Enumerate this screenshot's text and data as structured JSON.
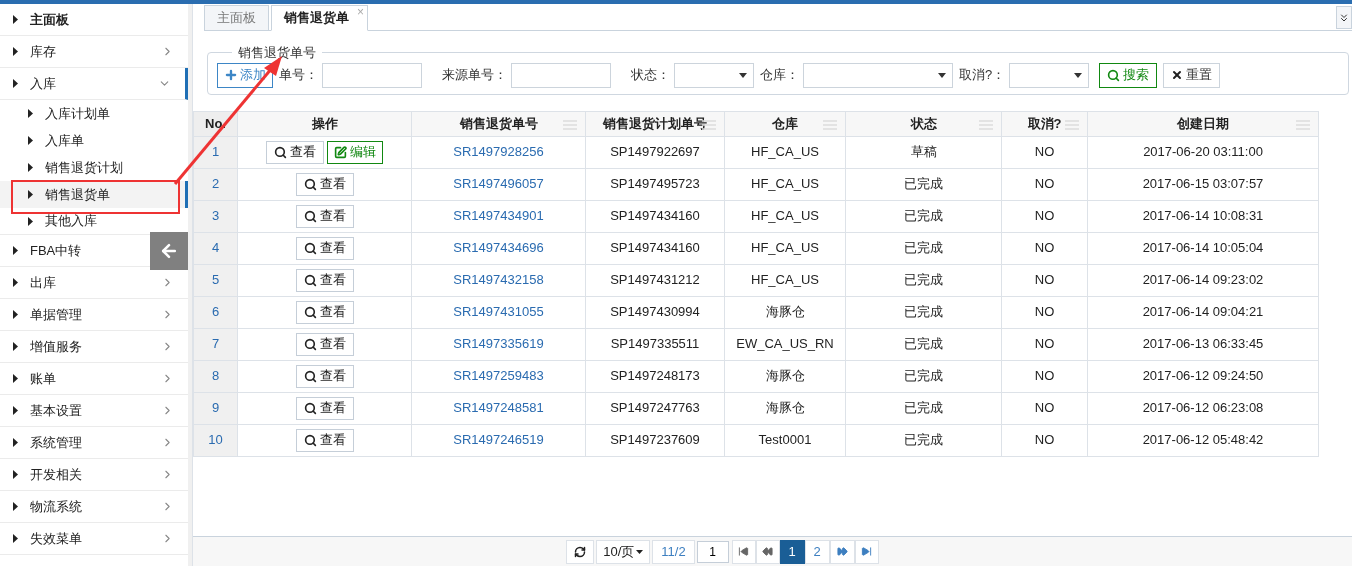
{
  "sidebar": {
    "items": [
      {
        "label": "主面板",
        "bold": true,
        "has_arrow": false,
        "expanded": false
      },
      {
        "label": "库存",
        "bold": false,
        "has_arrow": true,
        "expanded": false
      },
      {
        "label": "入库",
        "bold": false,
        "has_arrow": true,
        "expanded": true,
        "children": [
          {
            "label": "入库计划单",
            "selected": false
          },
          {
            "label": "入库单",
            "selected": false
          },
          {
            "label": "销售退货计划",
            "selected": false
          },
          {
            "label": "销售退货单",
            "selected": true
          },
          {
            "label": "其他入库",
            "selected": false
          }
        ]
      },
      {
        "label": "FBA中转",
        "bold": false,
        "has_arrow": false,
        "expanded": false,
        "collapse_button": true
      },
      {
        "label": "出库",
        "bold": false,
        "has_arrow": true,
        "expanded": false
      },
      {
        "label": "单据管理",
        "bold": false,
        "has_arrow": true,
        "expanded": false
      },
      {
        "label": "增值服务",
        "bold": false,
        "has_arrow": true,
        "expanded": false
      },
      {
        "label": "账单",
        "bold": false,
        "has_arrow": true,
        "expanded": false
      },
      {
        "label": "基本设置",
        "bold": false,
        "has_arrow": true,
        "expanded": false
      },
      {
        "label": "系统管理",
        "bold": false,
        "has_arrow": true,
        "expanded": false
      },
      {
        "label": "开发相关",
        "bold": false,
        "has_arrow": true,
        "expanded": false
      },
      {
        "label": "物流系统",
        "bold": false,
        "has_arrow": true,
        "expanded": false
      },
      {
        "label": "失效菜单",
        "bold": false,
        "has_arrow": true,
        "expanded": false
      }
    ]
  },
  "tabs": [
    {
      "label": "主面板",
      "selected": false
    },
    {
      "label": "销售退货单",
      "selected": true,
      "close": "×"
    }
  ],
  "filter": {
    "legend": "销售退货单号",
    "add_button": "添加",
    "fields": [
      {
        "kind": "input",
        "label": "单号："
      },
      {
        "kind": "input",
        "label": "来源单号："
      },
      {
        "kind": "select",
        "label": "状态：",
        "wide": false
      },
      {
        "kind": "select",
        "label": "仓库：",
        "wide": true
      },
      {
        "kind": "select",
        "label": "取消?：",
        "wide": false
      }
    ],
    "search_button": "搜索",
    "reset_button": "重置"
  },
  "table": {
    "columns": [
      {
        "label": "No.",
        "menu_icon": false
      },
      {
        "label": "操作",
        "menu_icon": false
      },
      {
        "label": "销售退货单号",
        "menu_icon": true
      },
      {
        "label": "销售退货计划单号",
        "menu_icon": true
      },
      {
        "label": "仓库",
        "menu_icon": true
      },
      {
        "label": "状态",
        "menu_icon": true
      },
      {
        "label": "取消?",
        "menu_icon": true
      },
      {
        "label": "创建日期",
        "menu_icon": true
      }
    ],
    "rows": [
      {
        "no": "1",
        "actions": [
          {
            "kind": "view",
            "label": "查看"
          },
          {
            "kind": "edit",
            "label": "编辑"
          }
        ],
        "order": "SR1497928256",
        "plan": "SP1497922697",
        "warehouse": "HF_CA_US",
        "status": "草稿",
        "cancelled": "NO",
        "created": "2017-06-20 03:11:00"
      },
      {
        "no": "2",
        "actions": [
          {
            "kind": "view",
            "label": "查看"
          }
        ],
        "order": "SR1497496057",
        "plan": "SP1497495723",
        "warehouse": "HF_CA_US",
        "status": "已完成",
        "cancelled": "NO",
        "created": "2017-06-15 03:07:57"
      },
      {
        "no": "3",
        "actions": [
          {
            "kind": "view",
            "label": "查看"
          }
        ],
        "order": "SR1497434901",
        "plan": "SP1497434160",
        "warehouse": "HF_CA_US",
        "status": "已完成",
        "cancelled": "NO",
        "created": "2017-06-14 10:08:31"
      },
      {
        "no": "4",
        "actions": [
          {
            "kind": "view",
            "label": "查看"
          }
        ],
        "order": "SR1497434696",
        "plan": "SP1497434160",
        "warehouse": "HF_CA_US",
        "status": "已完成",
        "cancelled": "NO",
        "created": "2017-06-14 10:05:04"
      },
      {
        "no": "5",
        "actions": [
          {
            "kind": "view",
            "label": "查看"
          }
        ],
        "order": "SR1497432158",
        "plan": "SP1497431212",
        "warehouse": "HF_CA_US",
        "status": "已完成",
        "cancelled": "NO",
        "created": "2017-06-14 09:23:02"
      },
      {
        "no": "6",
        "actions": [
          {
            "kind": "view",
            "label": "查看"
          }
        ],
        "order": "SR1497431055",
        "plan": "SP1497430994",
        "warehouse": "海豚仓",
        "status": "已完成",
        "cancelled": "NO",
        "created": "2017-06-14 09:04:21"
      },
      {
        "no": "7",
        "actions": [
          {
            "kind": "view",
            "label": "查看"
          }
        ],
        "order": "SR1497335619",
        "plan": "SP1497335511",
        "warehouse": "EW_CA_US_RN",
        "status": "已完成",
        "cancelled": "NO",
        "created": "2017-06-13 06:33:45"
      },
      {
        "no": "8",
        "actions": [
          {
            "kind": "view",
            "label": "查看"
          }
        ],
        "order": "SR1497259483",
        "plan": "SP1497248173",
        "warehouse": "海豚仓",
        "status": "已完成",
        "cancelled": "NO",
        "created": "2017-06-12 09:24:50"
      },
      {
        "no": "9",
        "actions": [
          {
            "kind": "view",
            "label": "查看"
          }
        ],
        "order": "SR1497248581",
        "plan": "SP1497247763",
        "warehouse": "海豚仓",
        "status": "已完成",
        "cancelled": "NO",
        "created": "2017-06-12 06:23:08"
      },
      {
        "no": "10",
        "actions": [
          {
            "kind": "view",
            "label": "查看"
          }
        ],
        "order": "SR1497246519",
        "plan": "SP1497237609",
        "warehouse": "Test0001",
        "status": "已完成",
        "cancelled": "NO",
        "created": "2017-06-12 05:48:42"
      }
    ]
  },
  "pagination": {
    "page_size": "10/页",
    "page_info": "11/2",
    "page_input": "1",
    "pages": [
      {
        "label": "1",
        "selected": true
      },
      {
        "label": "2",
        "selected": false
      }
    ]
  }
}
